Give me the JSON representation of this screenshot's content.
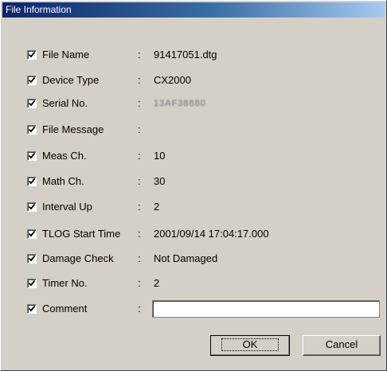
{
  "window": {
    "title": "File Information"
  },
  "rows": [
    {
      "label": "File Name",
      "colon": ":",
      "value": "91417051.dtg",
      "checked": true
    },
    {
      "label": "Device Type",
      "colon": ":",
      "value": "CX2000",
      "checked": true
    },
    {
      "label": "Serial No.",
      "colon": ":",
      "value": "13AF38880",
      "checked": true
    },
    {
      "label": "File Message",
      "colon": ":",
      "value": "",
      "checked": true
    },
    {
      "label": "Meas Ch.",
      "colon": ":",
      "value": "10",
      "checked": true
    },
    {
      "label": "Math Ch.",
      "colon": ":",
      "value": "30",
      "checked": true
    },
    {
      "label": "Interval Up",
      "colon": ":",
      "value": "2",
      "checked": true
    },
    {
      "label": "TLOG Start Time",
      "colon": ":",
      "value": "2001/09/14 17:04:17.000",
      "checked": true
    },
    {
      "label": "Damage Check",
      "colon": ":",
      "value": "Not Damaged",
      "checked": true
    },
    {
      "label": "Timer No.",
      "colon": ":",
      "value": "2",
      "checked": true
    },
    {
      "label": "Comment",
      "colon": ":",
      "value": "",
      "checked": true
    }
  ],
  "buttons": {
    "ok_label": "OK",
    "cancel_label": "Cancel"
  },
  "icons": {
    "checkbox_mark": "check-icon"
  }
}
